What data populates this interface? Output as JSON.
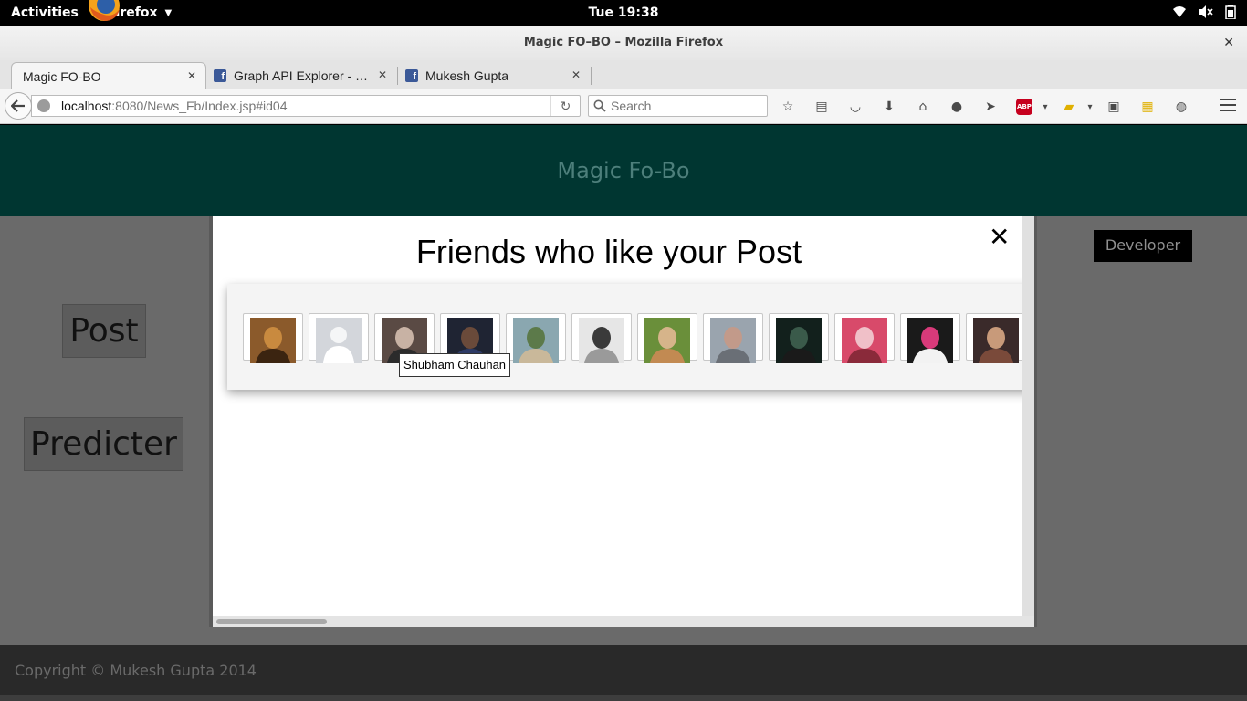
{
  "system_bar": {
    "activities": "Activities",
    "app_name": "Firefox",
    "clock": "Tue 19:38"
  },
  "window": {
    "title": "Magic FO–BO – Mozilla Firefox"
  },
  "tabs": [
    {
      "label": "Magic FO-BO",
      "active": true
    },
    {
      "label": "Graph API Explorer - …",
      "active": false
    },
    {
      "label": "Mukesh Gupta",
      "active": false
    }
  ],
  "navigation": {
    "url_host": "localhost",
    "url_rest": ":8080/News_Fb/Index.jsp#id04",
    "search_placeholder": "Search"
  },
  "page": {
    "site_title": "Magic Fo-Bo",
    "buttons": {
      "post": "Post",
      "predicter": "Predicter",
      "developer": "Developer"
    },
    "footer": "Copyright © Mukesh Gupta 2014"
  },
  "modal": {
    "title": "Friends who like your Post",
    "close_glyph": "✕",
    "hover_tooltip": "Shubham Chauhan",
    "friends": [
      {
        "icon": "lion-photo",
        "colors": [
          "#8b5a2b",
          "#c98a3f",
          "#3b2410"
        ]
      },
      {
        "icon": "default-profile-silhouette",
        "colors": [
          "#d3d6db",
          "#f5f6f7",
          "#ffffff"
        ]
      },
      {
        "icon": "two-friends-photo",
        "colors": [
          "#5a4a44",
          "#c8b2a4",
          "#2b2b2b"
        ]
      },
      {
        "icon": "bearded-man-photo",
        "colors": [
          "#1f2433",
          "#6a4a3a",
          "#2e3b66"
        ]
      },
      {
        "icon": "outdoor-lake-photo",
        "colors": [
          "#8aa7b0",
          "#5c7a4a",
          "#c9b89a"
        ]
      },
      {
        "icon": "monochrome-portrait-photo",
        "colors": [
          "#e6e6e6",
          "#3a3a3a",
          "#9a9a9a"
        ]
      },
      {
        "icon": "blond-guy-photo",
        "colors": [
          "#6a8f3a",
          "#d6b48a",
          "#c28a52"
        ]
      },
      {
        "icon": "landscape-man-photo",
        "colors": [
          "#9aa4ae",
          "#c29a8a",
          "#6a6f76"
        ]
      },
      {
        "icon": "sunglasses-guy-photo",
        "colors": [
          "#12201c",
          "#3a5a4a",
          "#1a1a1a"
        ]
      },
      {
        "icon": "collage-photo",
        "colors": [
          "#d84a6a",
          "#f0c0c8",
          "#8a2a3a"
        ]
      },
      {
        "icon": "pink-shirt-photo",
        "colors": [
          "#1a1a1a",
          "#d83a7a",
          "#f2f2f2"
        ]
      },
      {
        "icon": "group-photo",
        "colors": [
          "#3a2a2a",
          "#c89a7a",
          "#7a4a3a"
        ]
      }
    ]
  },
  "colors": {
    "header": "#003631",
    "overlay": "#6a6a6a",
    "footer": "#292929"
  }
}
